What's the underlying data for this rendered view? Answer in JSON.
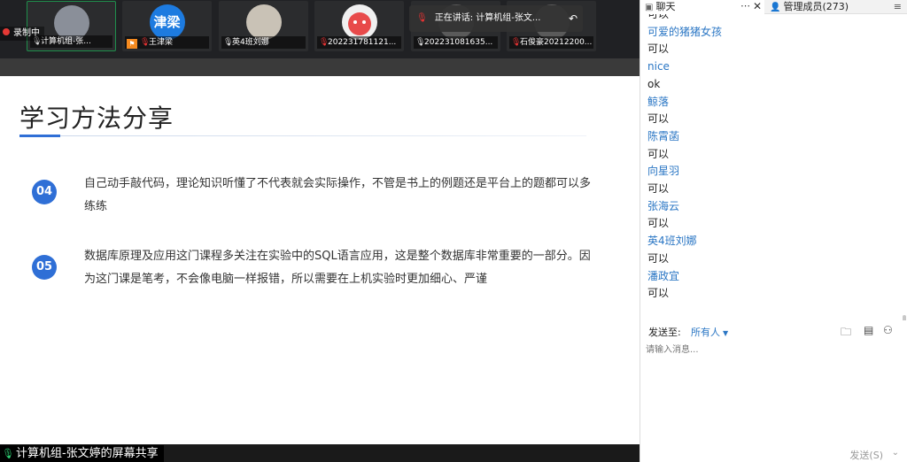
{
  "meeting": {
    "recording_label": "录制中",
    "speaking_label": "正在讲话: 计算机组-张文...",
    "participants": [
      {
        "name": "计算机组-张...",
        "avatar": "",
        "mic": "on",
        "active": true
      },
      {
        "name": "王津梁",
        "avatar": "津梁",
        "mic": "muted",
        "active": false
      },
      {
        "name": "英4班刘娜",
        "avatar": "",
        "mic": "on",
        "active": false
      },
      {
        "name": "202231781121...",
        "avatar": "",
        "mic": "muted",
        "active": false
      },
      {
        "name": "202231081635...",
        "avatar": "",
        "mic": "on",
        "active": false
      },
      {
        "name": "石俊豪20212200...",
        "avatar": "",
        "mic": "muted",
        "active": false
      }
    ],
    "screen_share_label": "计算机组-张文婷的屏幕共享"
  },
  "slide": {
    "title": "学习方法分享",
    "points": [
      {
        "num": "04",
        "text": "自己动手敲代码，理论知识听懂了不代表就会实际操作，不管是书上的例题还是平台上的题都可以多练练"
      },
      {
        "num": "05",
        "text": "数据库原理及应用这门课程多关注在实验中的SQL语言应用，这是整个数据库非常重要的一部分。因为这门课是笔考，不会像电脑一样报错，所以需要在上机实验时更加细心、严谨"
      }
    ]
  },
  "chat_panel": {
    "tab_chat": "聊天",
    "tab_members": "管理成员(273)",
    "messages": [
      {
        "sender": "",
        "content": "可以"
      },
      {
        "sender": "可爱的猪猪女孩",
        "content": "可以"
      },
      {
        "sender": "nice",
        "content": "ok"
      },
      {
        "sender": "鲸落",
        "content": "可以"
      },
      {
        "sender": "陈霄菡",
        "content": "可以"
      },
      {
        "sender": "向星羽",
        "content": "可以"
      },
      {
        "sender": "张海云",
        "content": "可以"
      },
      {
        "sender": "英4班刘娜",
        "content": "可以"
      },
      {
        "sender": "潘政宜",
        "content": "可以"
      }
    ],
    "send_to_label": "发送至:",
    "recipient": "所有人",
    "input_placeholder": "请输入消息...",
    "send_button": "发送(S)"
  },
  "colors": {
    "accent_blue": "#2f6fd6",
    "sender_blue": "#2a76c4",
    "recording_red": "#e53935",
    "active_green": "#1f8f4c"
  }
}
